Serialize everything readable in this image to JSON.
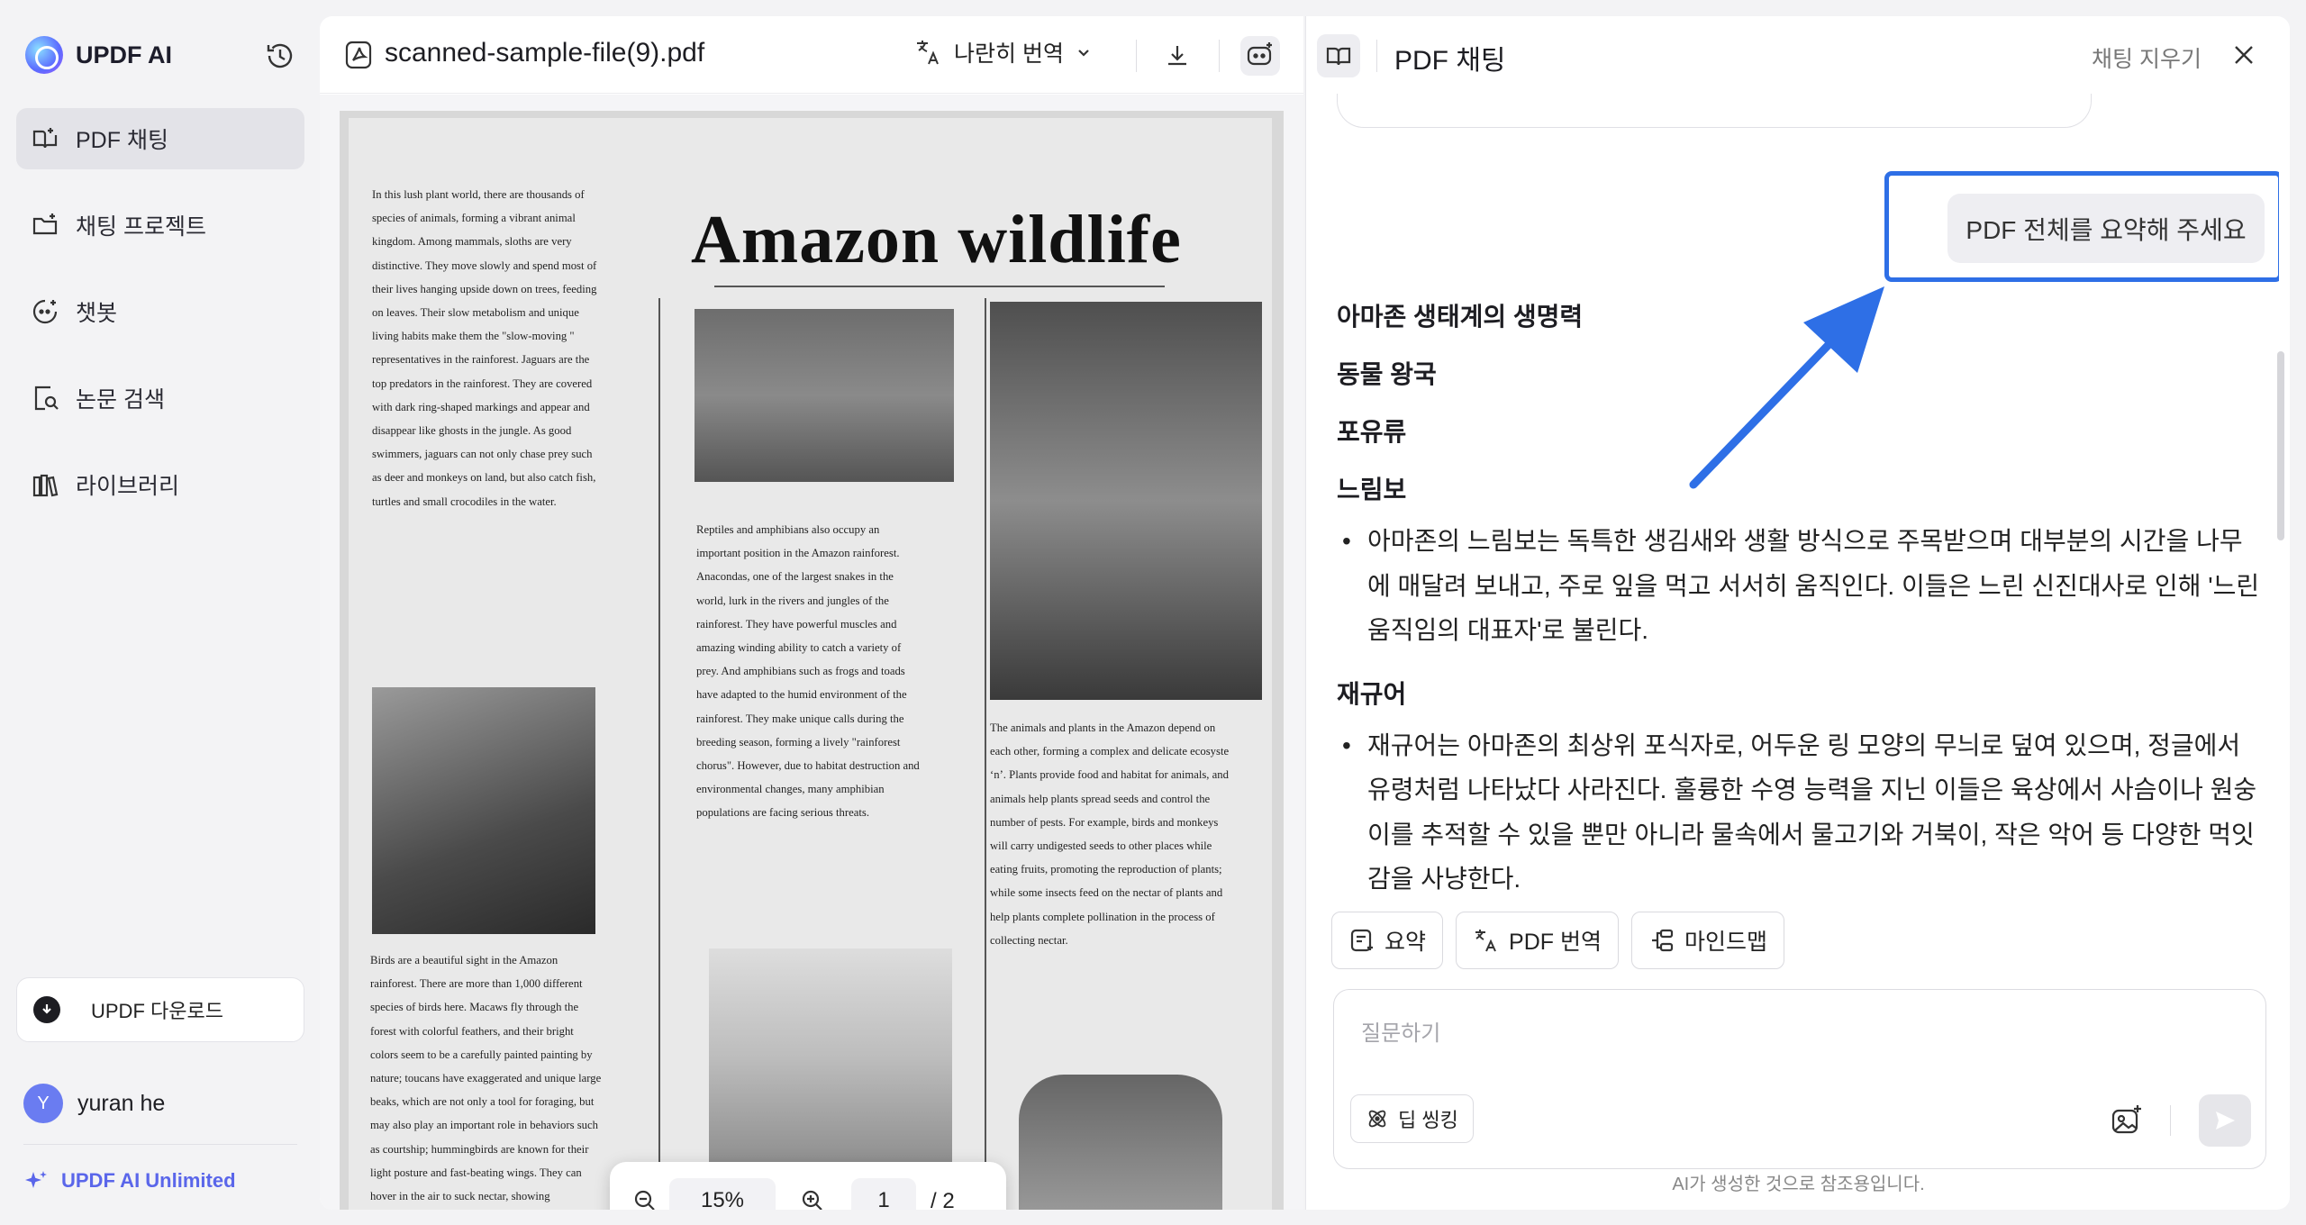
{
  "app": {
    "name": "UPDF AI"
  },
  "sidebar": {
    "items": [
      {
        "label": "PDF 채팅",
        "icon": "chat-book-icon",
        "active": true
      },
      {
        "label": "채팅 프로젝트",
        "icon": "folder-plus-icon",
        "active": false
      },
      {
        "label": "챗봇",
        "icon": "bot-icon",
        "active": false
      },
      {
        "label": "논문 검색",
        "icon": "paper-search-icon",
        "active": false
      },
      {
        "label": "라이브러리",
        "icon": "library-icon",
        "active": false
      }
    ],
    "download_label": "UPDF 다운로드",
    "user": {
      "initial": "Y",
      "name": "yuran he"
    },
    "plan_label": "UPDF AI Unlimited"
  },
  "document": {
    "file_name": "scanned-sample-file(9).pdf",
    "translate_label": "나란히 번역",
    "zoom": "15%",
    "page_current": "1",
    "page_total": "/ 2",
    "magazine": {
      "title": "Amazon wildlife",
      "col1": "In this lush plant world, there are thousands of species of animals, forming a vibrant animal kingdom. Among mammals, sloths are very distinctive. They move slowly and spend most of their lives hanging upside down on trees, feeding on leaves. Their slow metabolism and unique living habits make them the \"slow-moving \" representatives in the rainforest. Jaguars are the top predators in the rainforest. They are covered with dark ring-shaped markings and appear and disappear like ghosts in the jungle. As good swimmers, jaguars can not only chase prey such as deer and monkeys on land, but also catch fish, turtles and small crocodiles in the water.",
      "col1b": "Birds are a beautiful sight in the Amazon rainforest. There are more than 1,000 different species of birds here. Macaws fly through the forest with colorful feathers, and their bright colors seem to be a carefully painted painting by nature; toucans have exaggerated and unique large beaks, which are not only a tool for foraging, but may also play an important role in behaviors such as courtship; hummingbirds are known for their light posture and fast-beating wings. They can hover in the air to suck nectar, showing extraordinary flying skills.",
      "col2": "Reptiles and amphibians also occupy an important position in the Amazon rainforest. Anacondas, one of the largest snakes in the world, lurk in the rivers and jungles of the rainforest. They have powerful muscles and amazing winding ability to catch a variety of prey. And amphibians such as frogs and toads have adapted to the humid environment of the rainforest. They make unique calls during the breeding season, forming a lively \"rainforest chorus\". However, due to habitat destruction and environmental changes, many amphibian populations are facing serious threats.",
      "col3": "The animals and plants in the Amazon depend on each other, forming a complex and delicate ecosyste ‘n’. Plants provide food and habitat for animals, and animals help plants spread seeds and control the number of pests. For example, birds and monkeys will carry undigested seeds to other places while eating fruits, promoting the reproduction of plants; while some insects feed on the nectar of plants and help plants complete pollination in the process of collecting nectar."
    }
  },
  "chat": {
    "title": "PDF 채팅",
    "clear_label": "채팅 지우기",
    "user_message": "PDF 전체를 요약해 주세요",
    "answer": {
      "h1": "아마존 생태계의 생명력",
      "h2": "동물 왕국",
      "h3": "포유류",
      "h4": "느림보",
      "b1": "아마존의 느림보는 독특한 생김새와 생활 방식으로 주목받으며 대부분의 시간을 나무에 매달려 보내고, 주로 잎을 먹고 서서히 움직인다. 이들은 느린 신진대사로 인해 '느린 움직임의 대표자'로 불린다.",
      "h5": "재규어",
      "b2": "재규어는 아마존의 최상위 포식자로, 어두운 링 모양의 무늬로 덮여 있으며, 정글에서 유령처럼 나타났다 사라진다. 훌륭한 수영 능력을 지닌 이들은 육상에서 사슴이나 원숭이를 추적할 수 있을 뿐만 아니라 물속에서 물고기와 거북이, 작은 악어 등 다양한 먹잇감을 사냥한다."
    },
    "quick_actions": [
      {
        "label": "요약",
        "icon": "summary-icon"
      },
      {
        "label": "PDF 번역",
        "icon": "translate-icon"
      },
      {
        "label": "마인드맵",
        "icon": "mindmap-icon"
      }
    ],
    "input_placeholder": "질문하기",
    "deep_think_label": "딥 씽킹",
    "disclaimer": "AI가 생성한 것으로 참조용입니다."
  },
  "colors": {
    "accent": "#5a66ea",
    "highlight": "#2e6fe6"
  }
}
